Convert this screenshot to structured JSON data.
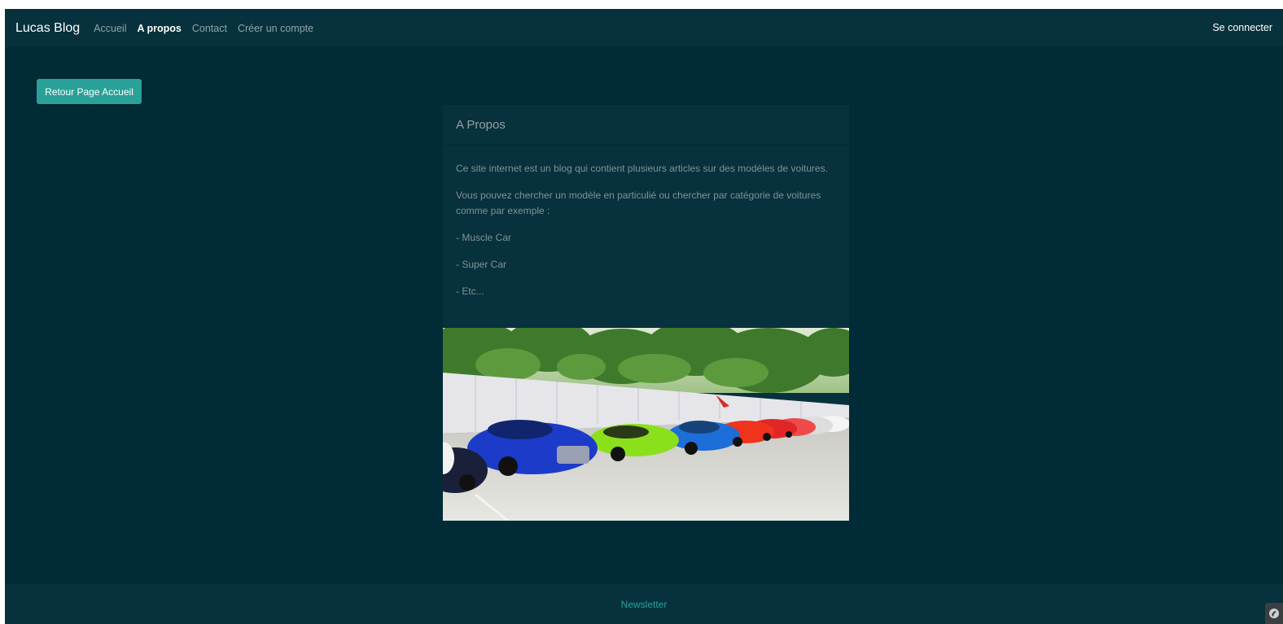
{
  "navbar": {
    "brand": "Lucas Blog",
    "links": [
      {
        "label": "Accueil",
        "active": false
      },
      {
        "label": "A propos",
        "active": true
      },
      {
        "label": "Contact",
        "active": false
      },
      {
        "label": "Créer un compte",
        "active": false
      }
    ],
    "login_label": "Se connecter"
  },
  "back_button": {
    "label": "Retour Page Accueil"
  },
  "card": {
    "title": "A Propos",
    "paragraphs": [
      "Ce site internet est un blog qui contient plusieurs articles sur des modèles de voitures.",
      "Vous pouvez chercher un modèle en particulié ou chercher par catégorie de voitures comme par exemple :",
      "- Muscle Car",
      "- Super Car",
      "- Etc..."
    ],
    "image_icon": "parked-sports-cars-photo"
  },
  "footer": {
    "newsletter_label": "Newsletter"
  },
  "corner_badge": {
    "icon": "debug-toolbar-icon"
  },
  "colors": {
    "page_bg": "#012b36",
    "surface": "#07313c",
    "accent": "#2aa198",
    "text_muted": "#7f9497",
    "nav_text": "#8fa6ab"
  }
}
